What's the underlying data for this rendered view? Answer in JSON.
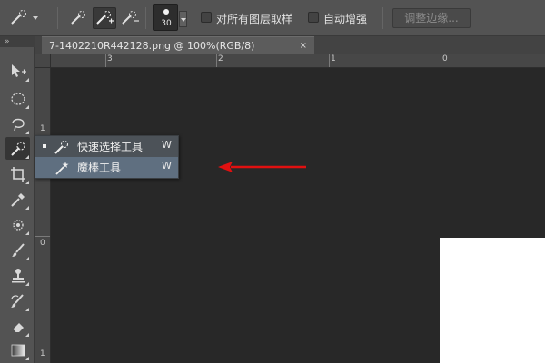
{
  "options_bar": {
    "brush_size": "30",
    "checkbox_sample_all_layers": {
      "label": "对所有图层取样",
      "checked": false
    },
    "checkbox_auto_enhance": {
      "label": "自动增强",
      "checked": false
    },
    "refine_edge_label": "调整边缘..."
  },
  "document_tab": {
    "title": "7-1402210R442128.png @ 100%(RGB/8)",
    "close_glyph": "×"
  },
  "rulers": {
    "top": [
      "3",
      "2",
      "1",
      "0"
    ],
    "left": [
      "1",
      "0",
      "1"
    ]
  },
  "toolbox": {
    "grip_glyph": "»",
    "tools": [
      "move-icon",
      "elliptical-marquee-icon",
      "lasso-icon",
      "quick-selection-icon",
      "crop-icon",
      "eyedropper-icon",
      "healing-brush-icon",
      "brush-icon",
      "clone-stamp-icon",
      "history-brush-icon",
      "eraser-icon",
      "gradient-icon"
    ],
    "active_tool": "quick-selection-icon"
  },
  "flyout": {
    "items": [
      {
        "label": "快速选择工具",
        "shortcut": "W",
        "selected": true
      },
      {
        "label": "魔棒工具",
        "shortcut": "W",
        "selected": false
      }
    ]
  },
  "colors": {
    "canvas_bg": "#282828",
    "panel_bg": "#535353",
    "flyout_hover": "#5f6f80",
    "annotation_arrow": "#e01010"
  }
}
